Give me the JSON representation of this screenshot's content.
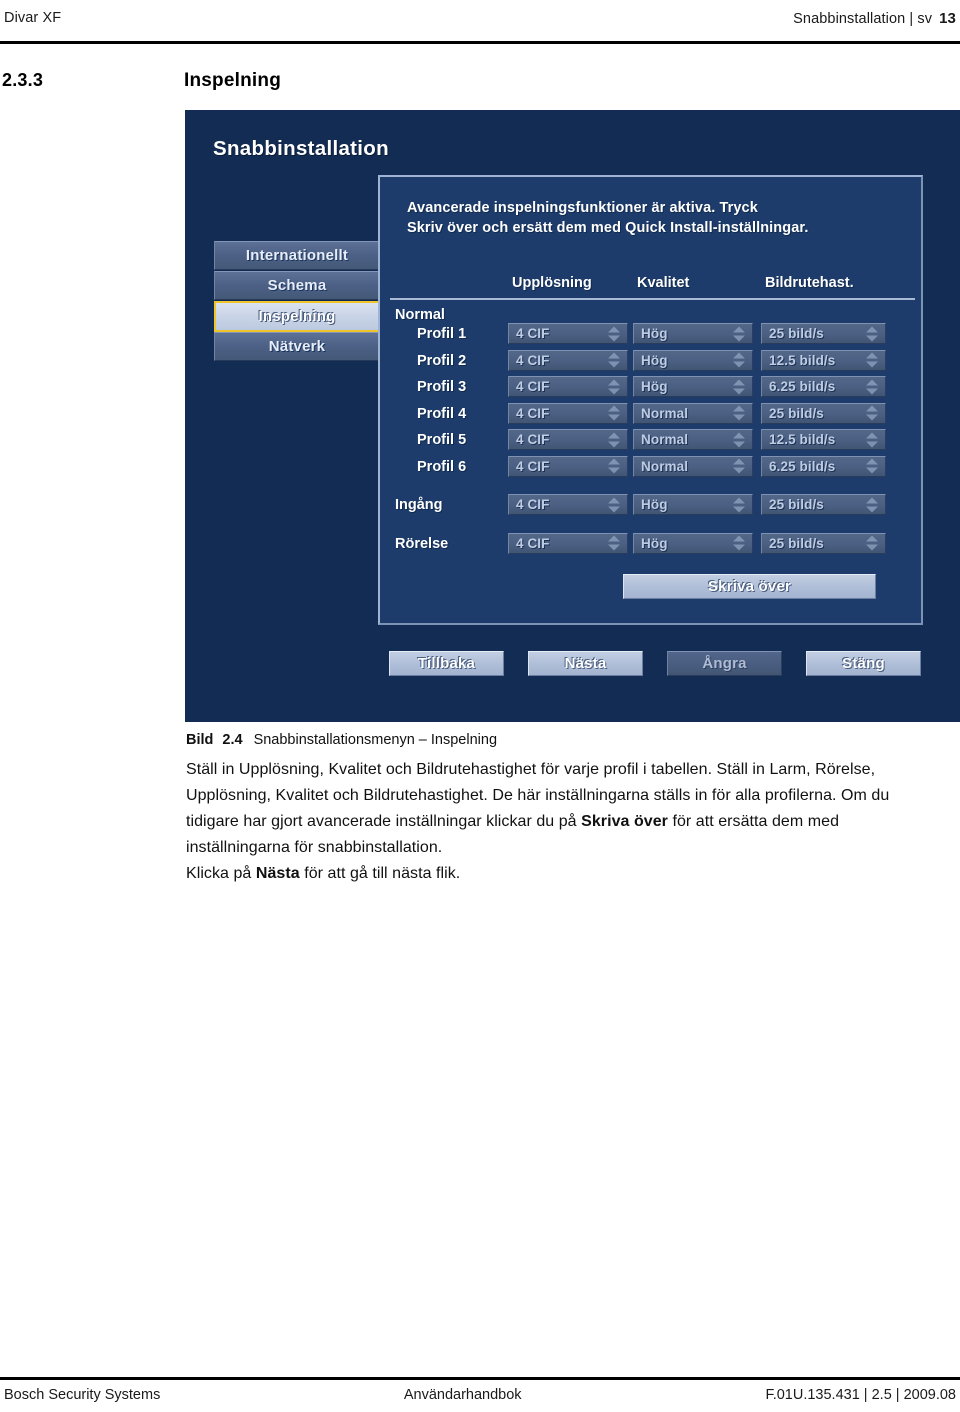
{
  "page_header": {
    "product": "Divar XF",
    "doc_section": "Snabbinstallation | sv",
    "page_number": "13"
  },
  "section": {
    "number": "2.3.3",
    "title": "Inspelning"
  },
  "screenshot": {
    "app_title": "Snabbinstallation",
    "sidebar": {
      "items": [
        {
          "label": "Internationellt",
          "selected": false
        },
        {
          "label": "Schema",
          "selected": false
        },
        {
          "label": "Inspelning",
          "selected": true
        },
        {
          "label": "Nätverk",
          "selected": false
        }
      ]
    },
    "panel": {
      "message_line1": "Avancerade inspelningsfunktioner är aktiva. Tryck",
      "message_line2": "Skriv över och ersätt dem med Quick Install-inställningar.",
      "table": {
        "headers": [
          "",
          "Upplösning",
          "Kvalitet",
          "Bildrutehast."
        ],
        "group_label": "Normal",
        "profile_rows": [
          {
            "label": "Profil 1",
            "resolution": "4 CIF",
            "quality": "Hög",
            "framerate": "25 bild/s"
          },
          {
            "label": "Profil 2",
            "resolution": "4 CIF",
            "quality": "Hög",
            "framerate": "12.5 bild/s"
          },
          {
            "label": "Profil 3",
            "resolution": "4 CIF",
            "quality": "Hög",
            "framerate": "6.25 bild/s"
          },
          {
            "label": "Profil 4",
            "resolution": "4 CIF",
            "quality": "Normal",
            "framerate": "25 bild/s"
          },
          {
            "label": "Profil 5",
            "resolution": "4 CIF",
            "quality": "Normal",
            "framerate": "12.5 bild/s"
          },
          {
            "label": "Profil 6",
            "resolution": "4 CIF",
            "quality": "Normal",
            "framerate": "6.25 bild/s"
          }
        ],
        "event_rows": [
          {
            "label": "Ingång",
            "resolution": "4 CIF",
            "quality": "Hög",
            "framerate": "25 bild/s"
          },
          {
            "label": "Rörelse",
            "resolution": "4 CIF",
            "quality": "Hög",
            "framerate": "25 bild/s"
          }
        ]
      },
      "overwrite_button": "Skriva över"
    },
    "wizard_buttons": [
      {
        "label": "Tillbaka",
        "disabled": false
      },
      {
        "label": "Nästa",
        "disabled": false
      },
      {
        "label": "Ångra",
        "disabled": true
      },
      {
        "label": "Stäng",
        "disabled": false
      }
    ],
    "colors": {
      "background": "#132c54",
      "panel_background": "#1d3c6b",
      "panel_border": "#9fb4d4",
      "selection_highlight": "#f0c52c",
      "button_face": "#b0bfd8"
    }
  },
  "figure_caption": {
    "label": "Bild",
    "number": "2.4",
    "text": "Snabbinstallationsmenyn – Inspelning"
  },
  "body_text": {
    "p1_a": "Ställ in Upplösning, Kvalitet och Bildrutehastighet för varje profil i tabellen. Ställ in Larm, Rörelse, Upplösning, Kvalitet och Bildrutehastighet. De här inställningarna ställs in för alla profilerna. Om du tidigare har gjort avancerade inställningar klickar du på ",
    "p1_bold": "Skriva över",
    "p1_b": " för att ersätta dem med inställningarna för snabbinstallation.",
    "p2_a": "Klicka på ",
    "p2_bold": "Nästa",
    "p2_b": " för att gå till nästa flik."
  },
  "page_footer": {
    "left": "Bosch Security Systems",
    "center": "Användarhandbok",
    "right": "F.01U.135.431 | 2.5 | 2009.08"
  }
}
